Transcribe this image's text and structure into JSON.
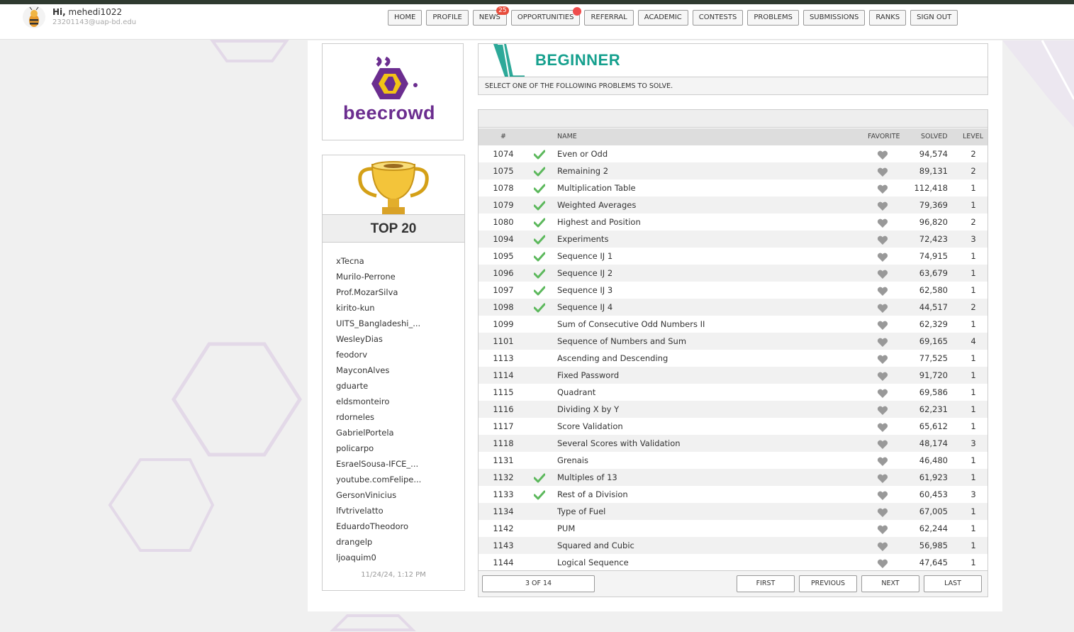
{
  "user": {
    "greeting": "Hi,",
    "username": "mehedi1022",
    "email": "23201143@uap-bd.edu"
  },
  "nav": [
    {
      "label": "HOME"
    },
    {
      "label": "PROFILE"
    },
    {
      "label": "NEWS",
      "badge": "25"
    },
    {
      "label": "OPPORTUNITIES",
      "dot": true
    },
    {
      "label": "REFERRAL"
    },
    {
      "label": "ACADEMIC"
    },
    {
      "label": "CONTESTS"
    },
    {
      "label": "PROBLEMS"
    },
    {
      "label": "SUBMISSIONS"
    },
    {
      "label": "RANKS"
    },
    {
      "label": "SIGN OUT"
    }
  ],
  "logo": {
    "text": "beecrowd"
  },
  "top20": {
    "title": "TOP 20",
    "users": [
      "xTecna",
      "Murilo-Perrone",
      "Prof.MozarSilva",
      "kirito-kun",
      "UITS_Bangladeshi_...",
      "WesleyDias",
      "feodorv",
      "MayconAlves",
      "gduarte",
      "eldsmonteiro",
      "rdorneles",
      "GabrielPortela",
      "policarpo",
      "EsraelSousa-IFCE_...",
      "youtube.comFelipe...",
      "GersonVinicius",
      "lfvtrivelatto",
      "EduardoTheodoro",
      "drangelp",
      "ljoaquim0"
    ],
    "timestamp": "11/24/24, 1:12 PM"
  },
  "category": {
    "title": "BEGINNER",
    "subtitle": "SELECT ONE OF THE FOLLOWING PROBLEMS TO SOLVE."
  },
  "table": {
    "headers": {
      "id": "#",
      "name": "NAME",
      "favorite": "FAVORITE",
      "solved": "SOLVED",
      "level": "LEVEL"
    },
    "rows": [
      {
        "id": "1074",
        "done": true,
        "name": "Even or Odd",
        "solved": "94,574",
        "level": "2"
      },
      {
        "id": "1075",
        "done": true,
        "name": "Remaining 2",
        "solved": "89,131",
        "level": "2"
      },
      {
        "id": "1078",
        "done": true,
        "name": "Multiplication Table",
        "solved": "112,418",
        "level": "1"
      },
      {
        "id": "1079",
        "done": true,
        "name": "Weighted Averages",
        "solved": "79,369",
        "level": "1"
      },
      {
        "id": "1080",
        "done": true,
        "name": "Highest and Position",
        "solved": "96,820",
        "level": "2"
      },
      {
        "id": "1094",
        "done": true,
        "name": "Experiments",
        "solved": "72,423",
        "level": "3"
      },
      {
        "id": "1095",
        "done": true,
        "name": "Sequence IJ 1",
        "solved": "74,915",
        "level": "1"
      },
      {
        "id": "1096",
        "done": true,
        "name": "Sequence IJ 2",
        "solved": "63,679",
        "level": "1"
      },
      {
        "id": "1097",
        "done": true,
        "name": "Sequence IJ 3",
        "solved": "62,580",
        "level": "1"
      },
      {
        "id": "1098",
        "done": true,
        "name": "Sequence IJ 4",
        "solved": "44,517",
        "level": "2"
      },
      {
        "id": "1099",
        "done": false,
        "name": "Sum of Consecutive Odd Numbers II",
        "solved": "62,329",
        "level": "1"
      },
      {
        "id": "1101",
        "done": false,
        "name": "Sequence of Numbers and Sum",
        "solved": "69,165",
        "level": "4"
      },
      {
        "id": "1113",
        "done": false,
        "name": "Ascending and Descending",
        "solved": "77,525",
        "level": "1"
      },
      {
        "id": "1114",
        "done": false,
        "name": "Fixed Password",
        "solved": "91,720",
        "level": "1"
      },
      {
        "id": "1115",
        "done": false,
        "name": "Quadrant",
        "solved": "69,586",
        "level": "1"
      },
      {
        "id": "1116",
        "done": false,
        "name": "Dividing X by Y",
        "solved": "62,231",
        "level": "1"
      },
      {
        "id": "1117",
        "done": false,
        "name": "Score Validation",
        "solved": "65,612",
        "level": "1"
      },
      {
        "id": "1118",
        "done": false,
        "name": "Several Scores with Validation",
        "solved": "48,174",
        "level": "3"
      },
      {
        "id": "1131",
        "done": false,
        "name": "Grenais",
        "solved": "46,480",
        "level": "1"
      },
      {
        "id": "1132",
        "done": true,
        "name": "Multiples of 13",
        "solved": "61,923",
        "level": "1"
      },
      {
        "id": "1133",
        "done": true,
        "name": "Rest of a Division",
        "solved": "60,453",
        "level": "3"
      },
      {
        "id": "1134",
        "done": false,
        "name": "Type of Fuel",
        "solved": "67,005",
        "level": "1"
      },
      {
        "id": "1142",
        "done": false,
        "name": "PUM",
        "solved": "62,244",
        "level": "1"
      },
      {
        "id": "1143",
        "done": false,
        "name": "Squared and Cubic",
        "solved": "56,985",
        "level": "1"
      },
      {
        "id": "1144",
        "done": false,
        "name": "Logical Sequence",
        "solved": "47,645",
        "level": "1"
      }
    ]
  },
  "pagination": {
    "info": "3 OF 14",
    "first": "FIRST",
    "previous": "PREVIOUS",
    "next": "NEXT",
    "last": "LAST"
  },
  "colors": {
    "brand": "#6b2d8f",
    "category": "#16a08e",
    "check": "#5cb85c",
    "badge": "#e74c3c"
  }
}
